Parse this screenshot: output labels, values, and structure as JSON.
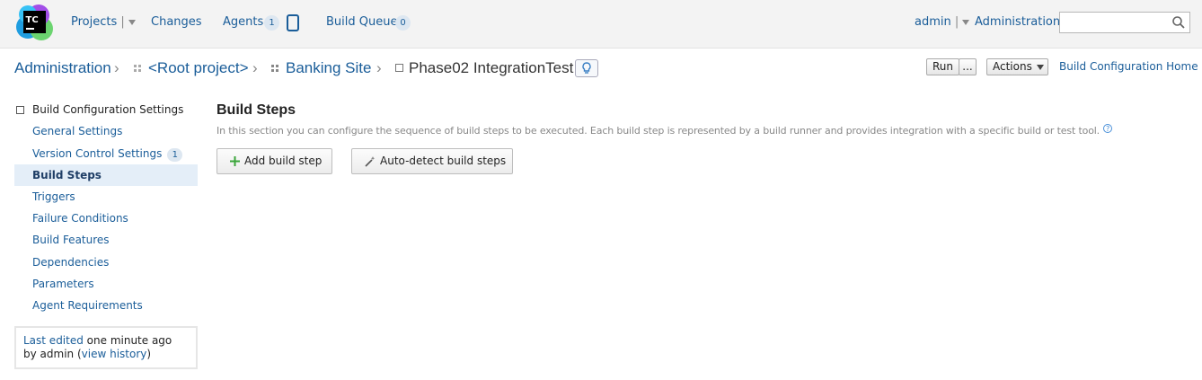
{
  "topbar": {
    "logo_text": "TC",
    "nav": {
      "projects": "Projects",
      "changes": "Changes",
      "agents": "Agents",
      "agents_count": "1",
      "build_queue": "Build Queue",
      "queue_count": "0"
    },
    "user": "admin",
    "administration": "Administration",
    "search_placeholder": ""
  },
  "breadcrumb": {
    "items": [
      "Administration",
      "<Root project>",
      "Banking Site"
    ],
    "current": "Phase02 IntegrationTest"
  },
  "actions": {
    "run": "Run",
    "run_more": "...",
    "actions": "Actions",
    "home_link": "Build Configuration Home"
  },
  "sidebar": {
    "header": "Build Configuration Settings",
    "items": [
      {
        "label": "General Settings"
      },
      {
        "label": "Version Control Settings",
        "badge": "1"
      },
      {
        "label": "Build Steps"
      },
      {
        "label": "Triggers"
      },
      {
        "label": "Failure Conditions"
      },
      {
        "label": "Build Features"
      },
      {
        "label": "Dependencies"
      },
      {
        "label": "Parameters"
      },
      {
        "label": "Agent Requirements"
      }
    ],
    "active_index": 2,
    "last_edited_link": "Last edited",
    "last_edited_time": " one minute ago",
    "by_user": "by admin  (",
    "view_history": "view history",
    "close_paren": ")"
  },
  "main": {
    "title": "Build Steps",
    "description": "In this section you can configure the sequence of build steps to be executed. Each build step is represented by a build runner and provides integration with a specific build or test tool.",
    "add_button": "Add build step",
    "autodetect_button": "Auto-detect build steps"
  },
  "colors": {
    "link": "#1a5d99",
    "active_bg": "#e4eef8",
    "topbar_bg": "#f3f3f3"
  }
}
